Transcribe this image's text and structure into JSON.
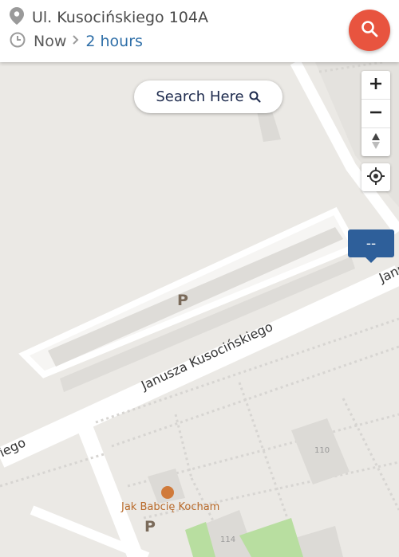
{
  "header": {
    "address": "Ul. Kusocińskiego 104A",
    "time_now": "Now",
    "duration": "2 hours"
  },
  "map": {
    "search_here_label": "Search Here",
    "pin_value": "--",
    "street_name_main": "Janusza Kusocińskiego",
    "street_name_right": "Janu",
    "street_name_left": "iego",
    "parking_label": "P",
    "poi_name": "Jak Babcię Kocham",
    "building_110": "110",
    "building_114": "114"
  },
  "colors": {
    "accent_search": "#e8543f",
    "pin": "#2e5f9a",
    "link": "#2f6fa8"
  },
  "icons": [
    "location-pin-icon",
    "clock-icon",
    "chevron-right-icon",
    "search-icon",
    "zoom-in-icon",
    "zoom-out-icon",
    "compass-icon",
    "locate-me-icon",
    "restaurant-icon"
  ]
}
